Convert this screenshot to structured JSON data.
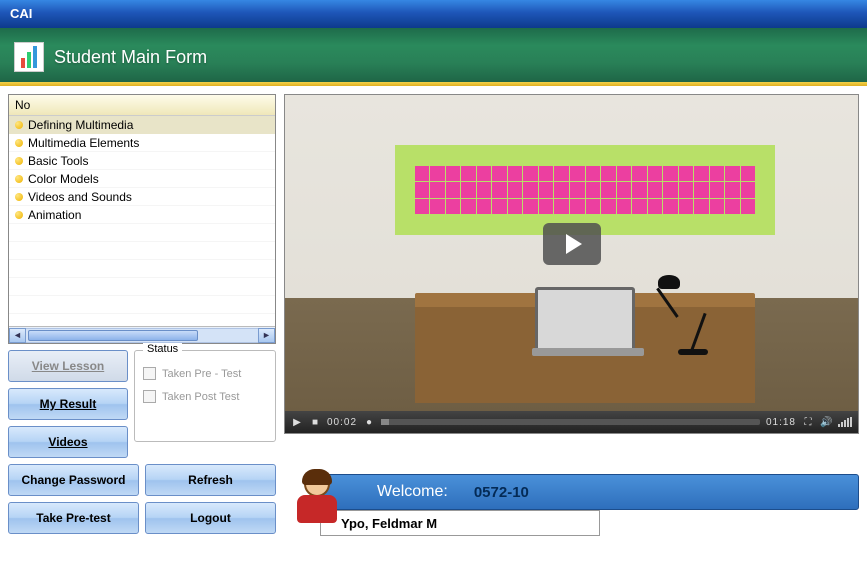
{
  "window": {
    "title": "CAI"
  },
  "banner": {
    "title": "Student Main Form"
  },
  "lesson_header": "No",
  "lessons": [
    {
      "label": "Defining Multimedia",
      "selected": true
    },
    {
      "label": "Multimedia Elements",
      "selected": false
    },
    {
      "label": "Basic Tools",
      "selected": false
    },
    {
      "label": "Color Models",
      "selected": false
    },
    {
      "label": "Videos and Sounds",
      "selected": false
    },
    {
      "label": "Animation",
      "selected": false
    }
  ],
  "buttons": {
    "view_lesson": "View Lesson",
    "my_result": "My Result",
    "videos": "Videos",
    "change_password": "Change Password",
    "take_pretest": "Take Pre-test",
    "refresh": "Refresh",
    "logout": "Logout"
  },
  "status": {
    "legend": "Status",
    "pretest": "Taken Pre - Test",
    "posttest": "Taken Post Test"
  },
  "video": {
    "current_time": "00:02",
    "total_time": "01:18"
  },
  "welcome": {
    "label": "Welcome:",
    "student_id": "0572-10",
    "student_name": "Ypo, Feldmar M"
  }
}
